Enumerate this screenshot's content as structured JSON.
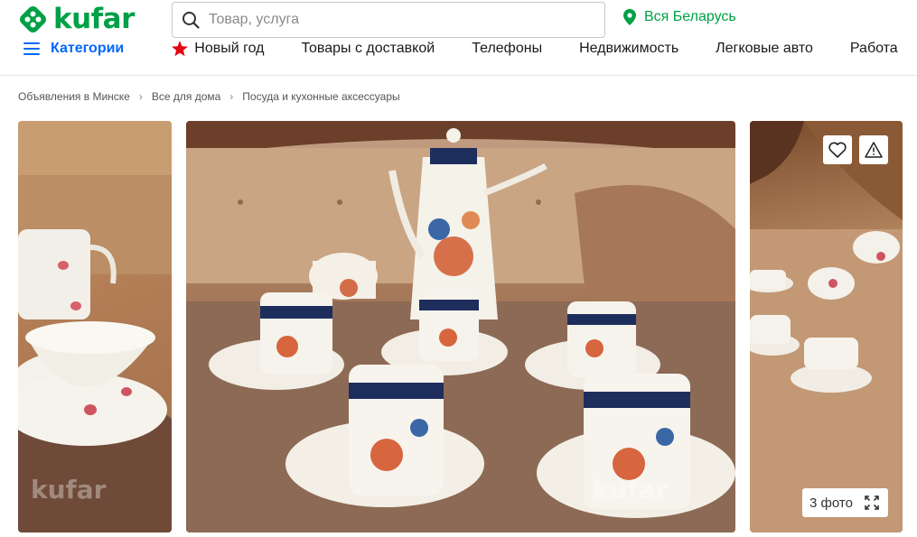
{
  "brand": {
    "name": "kufar",
    "color": "#00a046"
  },
  "search": {
    "placeholder": "Товар, услуга",
    "icon": "search-icon"
  },
  "region": {
    "label": "Вся Беларусь",
    "icon": "location-pin-icon"
  },
  "nav": {
    "categories_label": "Категории",
    "items": [
      "Новый год",
      "Товары с доставкой",
      "Телефоны",
      "Недвижимость",
      "Легковые авто",
      "Работа"
    ]
  },
  "breadcrumbs": [
    "Объявления в Минске",
    "Все для дома",
    "Посуда и кухонные аксессуары"
  ],
  "gallery": {
    "photo_count_label": "3 фото",
    "watermark": "kufar"
  },
  "colors": {
    "accent": "#00a046",
    "link_blue": "#0067ff",
    "festive_red": "#e30613"
  }
}
